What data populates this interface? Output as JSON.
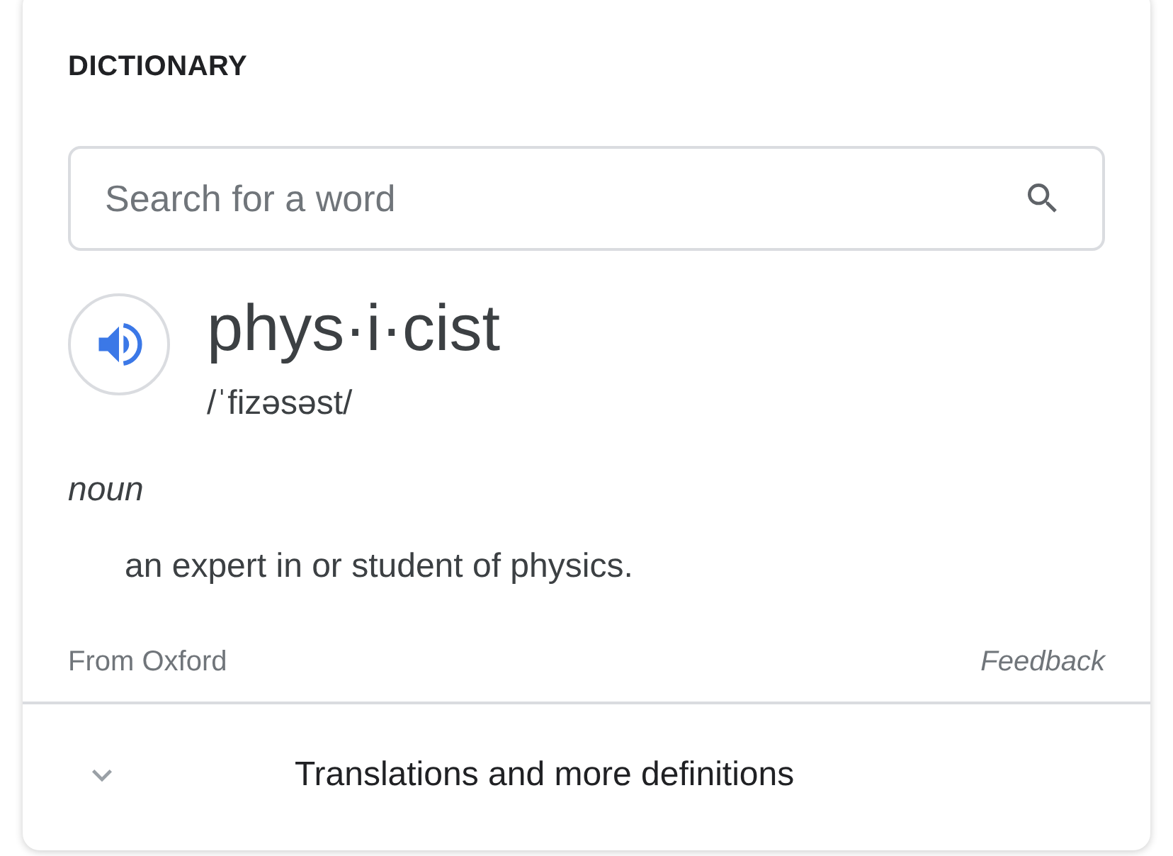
{
  "heading": "DICTIONARY",
  "search": {
    "placeholder": "Search for a word"
  },
  "entry": {
    "word": "phys·i·cist",
    "phonetic": "/ˈfizəsəst/",
    "part_of_speech": "noun",
    "definition": "an expert in or student of physics."
  },
  "footer": {
    "source": "From Oxford",
    "feedback": "Feedback"
  },
  "expander": {
    "label": "Translations and more definitions",
    "expanded": false
  }
}
